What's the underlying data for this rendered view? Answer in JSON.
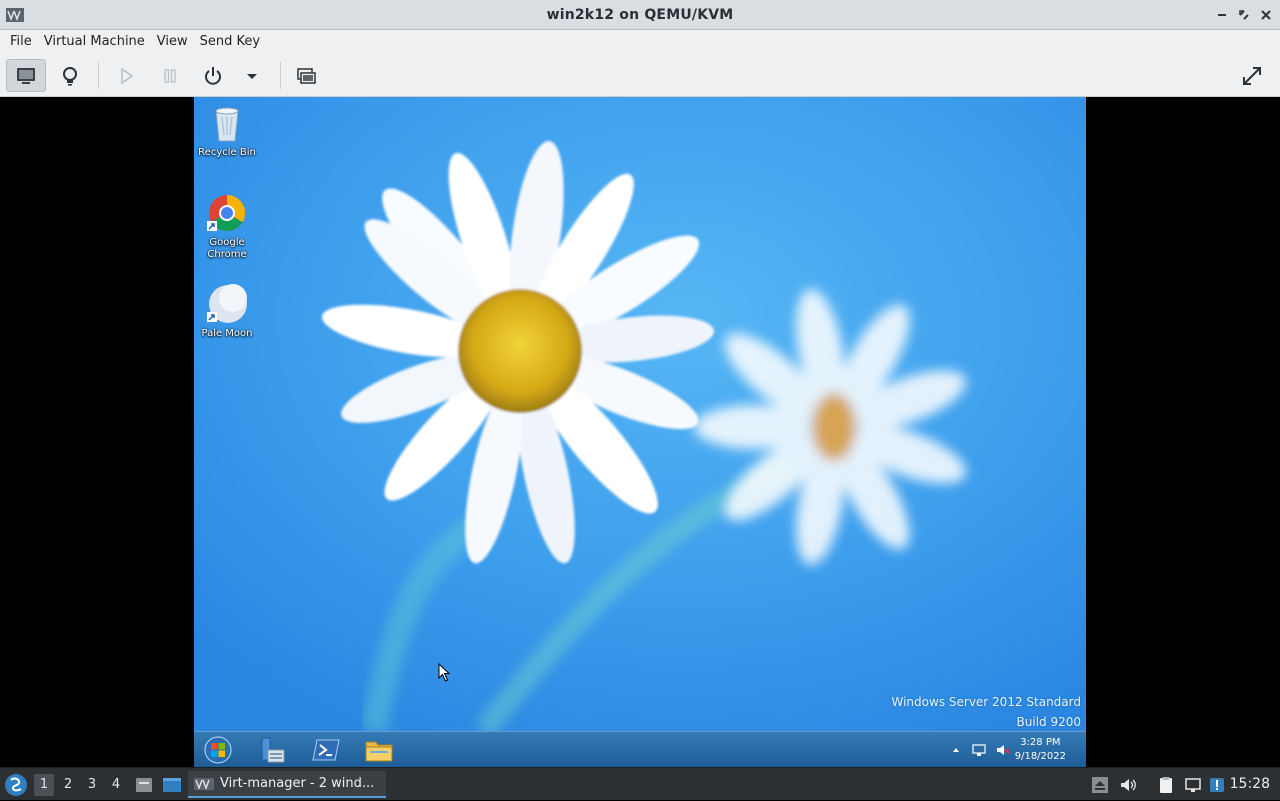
{
  "window": {
    "title": "win2k12 on QEMU/KVM"
  },
  "menubar": {
    "items": [
      "File",
      "Virtual Machine",
      "View",
      "Send Key"
    ]
  },
  "toolbar": {
    "buttons": [
      "show-console",
      "show-details",
      "run",
      "pause",
      "shutdown",
      "shutdown-menu",
      "snapshots",
      "fullscreen"
    ]
  },
  "guest": {
    "desktop_icons": [
      {
        "label": "Recycle Bin",
        "icon": "recycle-bin-icon"
      },
      {
        "label": "Google\nChrome",
        "icon": "chrome-icon"
      },
      {
        "label": "Pale Moon",
        "icon": "pale-moon-icon"
      }
    ],
    "watermark": {
      "line1": "Windows Server 2012 Standard",
      "line2": "Build 9200"
    },
    "taskbar": {
      "pinned": [
        "start-orb-icon",
        "server-manager-icon",
        "powershell-icon",
        "file-explorer-icon"
      ],
      "clock_time": "3:28 PM",
      "clock_date": "9/18/2022"
    }
  },
  "host_taskbar": {
    "workspaces": [
      "1",
      "2",
      "3",
      "4"
    ],
    "active_workspace": "1",
    "task_label": "Virt-manager - 2 wind...",
    "clock": "15:28"
  },
  "colors": {
    "guest_sky": "#3fa2f0",
    "host_taskbar": "#2c3033",
    "task_accent": "#5a9bd5"
  }
}
